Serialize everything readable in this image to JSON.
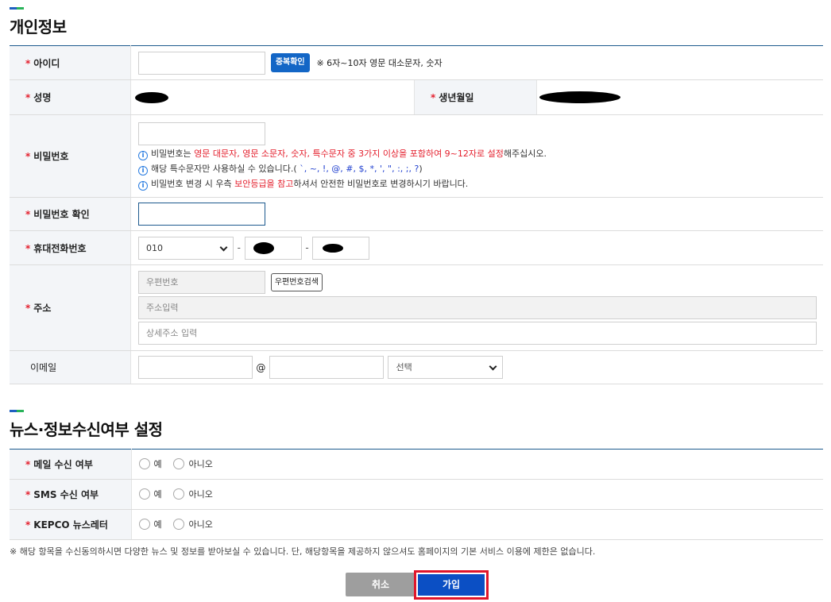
{
  "personal": {
    "title": "개인정보",
    "id": {
      "label": "아이디",
      "check_button": "중복확인",
      "note": "※ 6자~10자 영문 대소문자, 숫자"
    },
    "name": {
      "label": "성명"
    },
    "birth": {
      "label": "생년월일"
    },
    "password": {
      "label": "비밀번호",
      "hint1": {
        "a": "비밀번호는 ",
        "b": "영문 대문자, 영문 소문자, 숫자, 특수문자 중 3가지 이상을 포함하여 9~12자로 설정",
        "c": "해주십시오."
      },
      "hint2": {
        "a": "해당 특수문자만 사용하실 수 있습니다.(",
        "b": " `,  ~,  !,  @,  #,  $,  *,  ',  \",  :,  ;,  ?",
        "c": ")"
      },
      "hint3": {
        "a": "비밀번호 변경 시 우측 ",
        "b": "보안등급을 참고",
        "c": "하셔서 안전한 비밀번호로 변경하시기 바랍니다."
      }
    },
    "password_confirm": {
      "label": "비밀번호 확인"
    },
    "mobile": {
      "label": "휴대전화번호",
      "prefix": "010",
      "separator": "-"
    },
    "address": {
      "label": "주소",
      "zip_placeholder": "우편번호",
      "search_button": "우편번호검색",
      "addr_placeholder": "주소입력",
      "detail_placeholder": "상세주소 입력"
    },
    "email": {
      "label": "이메일",
      "at": "@",
      "domain_select": "선택"
    }
  },
  "news": {
    "title": "뉴스·정보수신여부 설정",
    "rows": [
      {
        "label": "메일 수신 여부",
        "yes": "예",
        "no": "아니오"
      },
      {
        "label": "SMS 수신 여부",
        "yes": "예",
        "no": "아니오"
      },
      {
        "label": "KEPCO 뉴스레터",
        "yes": "예",
        "no": "아니오"
      }
    ]
  },
  "footnote": "※ 해당 항목을 수신동의하시면 다양한 뉴스 및 정보를 받아보실 수 있습니다. 단, 해당항목을 제공하지 않으셔도 홈페이지의 기본 서비스 이용에 제한은 없습니다.",
  "actions": {
    "cancel": "취소",
    "join": "가입"
  },
  "colors": {
    "accent_blue": "#1366c6",
    "required_red": "#e4202e",
    "highlight_red": "#e0162b"
  }
}
